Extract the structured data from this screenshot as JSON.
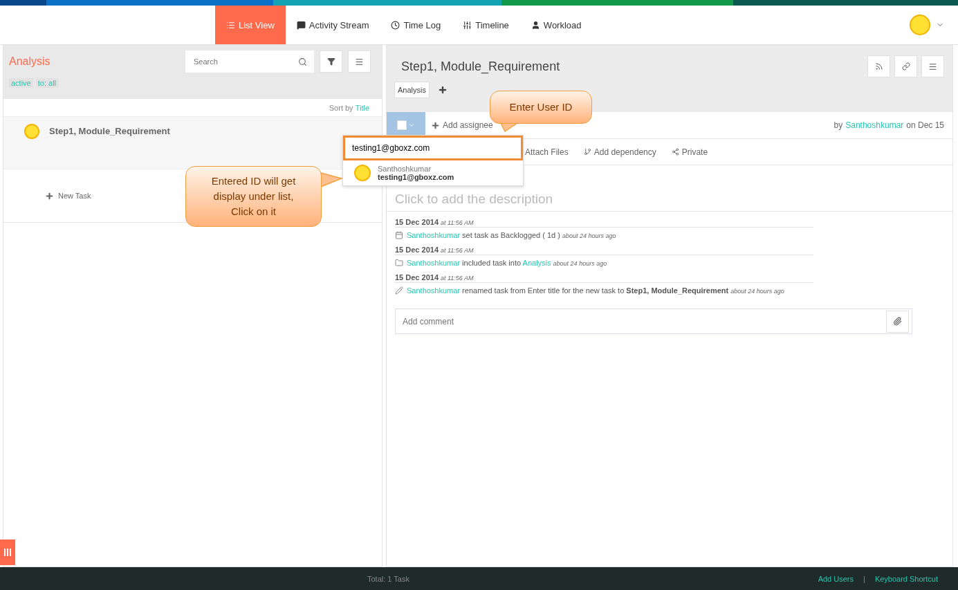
{
  "nav": {
    "tabs": [
      {
        "label": "List View",
        "selected": true
      },
      {
        "label": "Activity Stream",
        "selected": false
      },
      {
        "label": "Time Log",
        "selected": false
      },
      {
        "label": "Timeline",
        "selected": false
      },
      {
        "label": "Workload",
        "selected": false
      }
    ]
  },
  "left": {
    "title": "Analysis",
    "search": {
      "placeholder": "Search"
    },
    "filters": [
      "active",
      "to: all"
    ],
    "sort": {
      "label": "Sort by",
      "value": "Title"
    },
    "tasks": [
      {
        "title": "Step1, Module_Requirement"
      }
    ],
    "new_task": "New Task"
  },
  "task": {
    "title": "Step1, Module_Requirement",
    "tags": [
      "Analysis"
    ],
    "checked": false,
    "add_assignee": "Add assignee",
    "by": "by",
    "author": "Santhoshkumar",
    "date": "on Dec 15",
    "actions": [
      {
        "kind": "attach",
        "label": "Attach Files"
      },
      {
        "kind": "dependency",
        "label": "Add dependency"
      },
      {
        "kind": "share",
        "label": "Private"
      }
    ],
    "description_placeholder": "Click to add the description",
    "activity": [
      {
        "date": "15 Dec 2014",
        "time": "at 11:56 AM",
        "kind": "calendar",
        "user": "Santhoshkumar",
        "text": "set task as Backlogged ( 1d )",
        "ago": "about 24 hours ago"
      },
      {
        "date": "15 Dec 2014",
        "time": "at 11:56 AM",
        "kind": "folder",
        "user": "Santhoshkumar",
        "text": "included task into",
        "link": "Analysis",
        "ago": "about 24 hours ago"
      },
      {
        "date": "15 Dec 2014",
        "time": "at 11:56 AM",
        "kind": "pencil",
        "user": "Santhoshkumar",
        "text": "renamed task from Enter title for the new task to **Step1, Module_Requirement**",
        "ago": "about 24 hours ago"
      }
    ],
    "comment": {
      "placeholder": "Add comment"
    }
  },
  "assignee_dropdown": {
    "value": "testing1@gboxz.com",
    "results": [
      {
        "name": "Santhoshkumar",
        "email": "testing1@gboxz.com"
      }
    ]
  },
  "callouts": [
    {
      "text": "Enter User ID"
    },
    {
      "text": "Entered ID will get display under list, Click on it"
    }
  ],
  "footer": {
    "total": "Total: 1 Task",
    "links": [
      "Add Users",
      "Keyboard Shortcut"
    ],
    "separator": "|"
  }
}
